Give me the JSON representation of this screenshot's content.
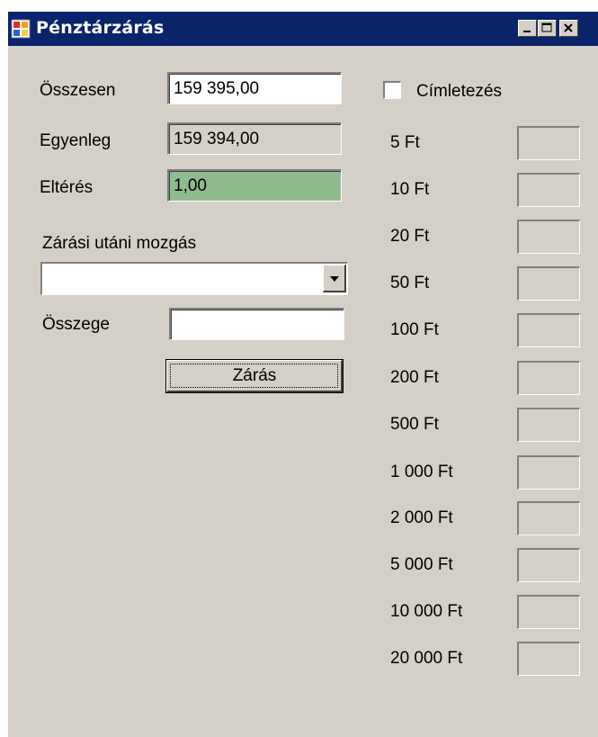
{
  "window": {
    "title": "Pénztárzárás"
  },
  "form": {
    "osszesen_label": "Összesen",
    "osszesen_value": "159 395,00",
    "egyenleg_label": "Egyenleg",
    "egyenleg_value": "159 394,00",
    "elteres_label": "Eltérés",
    "elteres_value": "1,00",
    "elteres_bg": "#8fbc8f",
    "mozgas_label": "Zárási utáni mozgás",
    "mozgas_selected": "",
    "osszege_label": "Összege",
    "osszege_value": "",
    "close_button": "Zárás"
  },
  "cimletezes": {
    "label": "Címletezés",
    "checked": false,
    "denominations": [
      {
        "label": "5 Ft",
        "value": ""
      },
      {
        "label": "10 Ft",
        "value": ""
      },
      {
        "label": "20 Ft",
        "value": ""
      },
      {
        "label": "50 Ft",
        "value": ""
      },
      {
        "label": "100 Ft",
        "value": ""
      },
      {
        "label": "200 Ft",
        "value": ""
      },
      {
        "label": "500 Ft",
        "value": ""
      },
      {
        "label": "1 000 Ft",
        "value": ""
      },
      {
        "label": "2 000 Ft",
        "value": ""
      },
      {
        "label": "5 000 Ft",
        "value": ""
      },
      {
        "label": "10 000 Ft",
        "value": ""
      },
      {
        "label": "20 000 Ft",
        "value": ""
      }
    ]
  },
  "colors": {
    "titlebar": "#0a246a",
    "window_bg": "#d4d0c8"
  }
}
